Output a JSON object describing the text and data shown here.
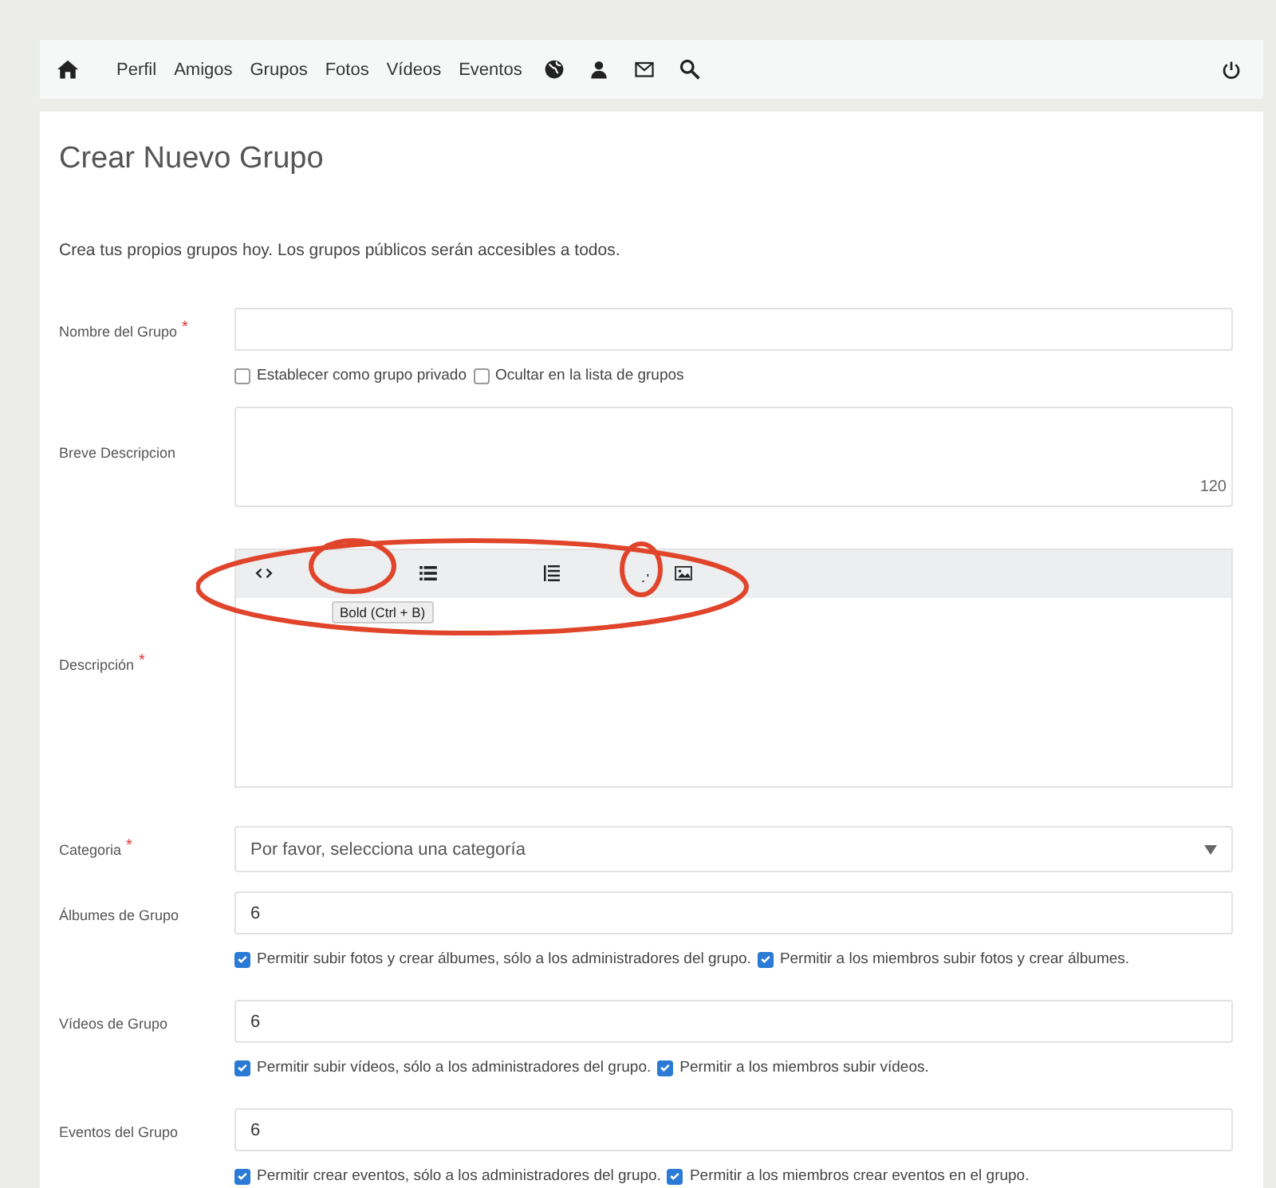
{
  "nav": {
    "links": [
      "Perfil",
      "Amigos",
      "Grupos",
      "Fotos",
      "Vídeos",
      "Eventos"
    ]
  },
  "page": {
    "title": "Crear Nuevo Grupo",
    "intro": "Crea tus propios grupos hoy. Los grupos públicos serán accesibles a todos."
  },
  "fields": [
    {
      "kind": "text",
      "label": "Nombre del Grupo",
      "required_mark": "*",
      "options": [
        {
          "label": "Establecer como grupo privado",
          "checked": false
        },
        {
          "label": "Ocultar en la lista de grupos",
          "checked": false
        }
      ]
    },
    {
      "kind": "textarea",
      "label": "Breve Descripcion",
      "counter": "120"
    },
    {
      "kind": "editor",
      "label": "Descripción",
      "required_mark": "*",
      "tooltip": "Bold (Ctrl + B)"
    },
    {
      "kind": "select",
      "label": "Categoria",
      "required_mark": "*",
      "placeholder": "Por favor, selecciona una categoría"
    },
    {
      "kind": "text",
      "label": "Álbumes de Grupo",
      "value": "6",
      "options": [
        {
          "label": "Permitir subir fotos y crear álbumes, sólo a los administradores del grupo.",
          "checked": true
        },
        {
          "label": "Permitir a los miembros subir fotos y crear álbumes.",
          "checked": true
        }
      ]
    },
    {
      "kind": "text",
      "label": "Vídeos de Grupo",
      "value": "6",
      "options": [
        {
          "label": "Permitir subir vídeos, sólo a los administradores del grupo.",
          "checked": true
        },
        {
          "label": "Permitir a los miembros subir vídeos.",
          "checked": true
        }
      ]
    },
    {
      "kind": "text",
      "label": "Eventos del Grupo",
      "value": "6",
      "options": [
        {
          "label": "Permitir crear eventos, sólo a los administradores del grupo.",
          "checked": true
        },
        {
          "label": "Permitir a los miembros crear eventos en el grupo.",
          "checked": true
        }
      ]
    }
  ]
}
